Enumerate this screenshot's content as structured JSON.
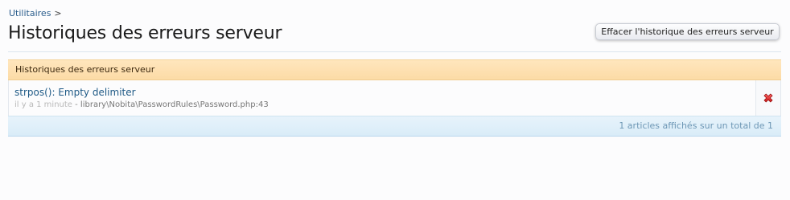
{
  "breadcrumb": {
    "items": [
      {
        "label": "Utilitaires"
      }
    ],
    "separator": ">"
  },
  "page": {
    "title": "Historiques des erreurs serveur"
  },
  "actions": {
    "clear_label": "Effacer l'historique des erreurs serveur"
  },
  "list": {
    "header": "Historiques des erreurs serveur",
    "rows": [
      {
        "title": "strpos(): Empty delimiter",
        "time": "il y a 1 minute",
        "separator": " - ",
        "path": "library\\Nobita\\PasswordRules\\Password.php:43",
        "delete_icon": "delete-x-icon"
      }
    ],
    "footer": "1 articles affichés sur un total de 1"
  },
  "colors": {
    "header_bg": "#fcdba6",
    "footer_bg": "#d9ecf8",
    "link": "#2a5d8c",
    "delete_icon": "#e02424"
  }
}
